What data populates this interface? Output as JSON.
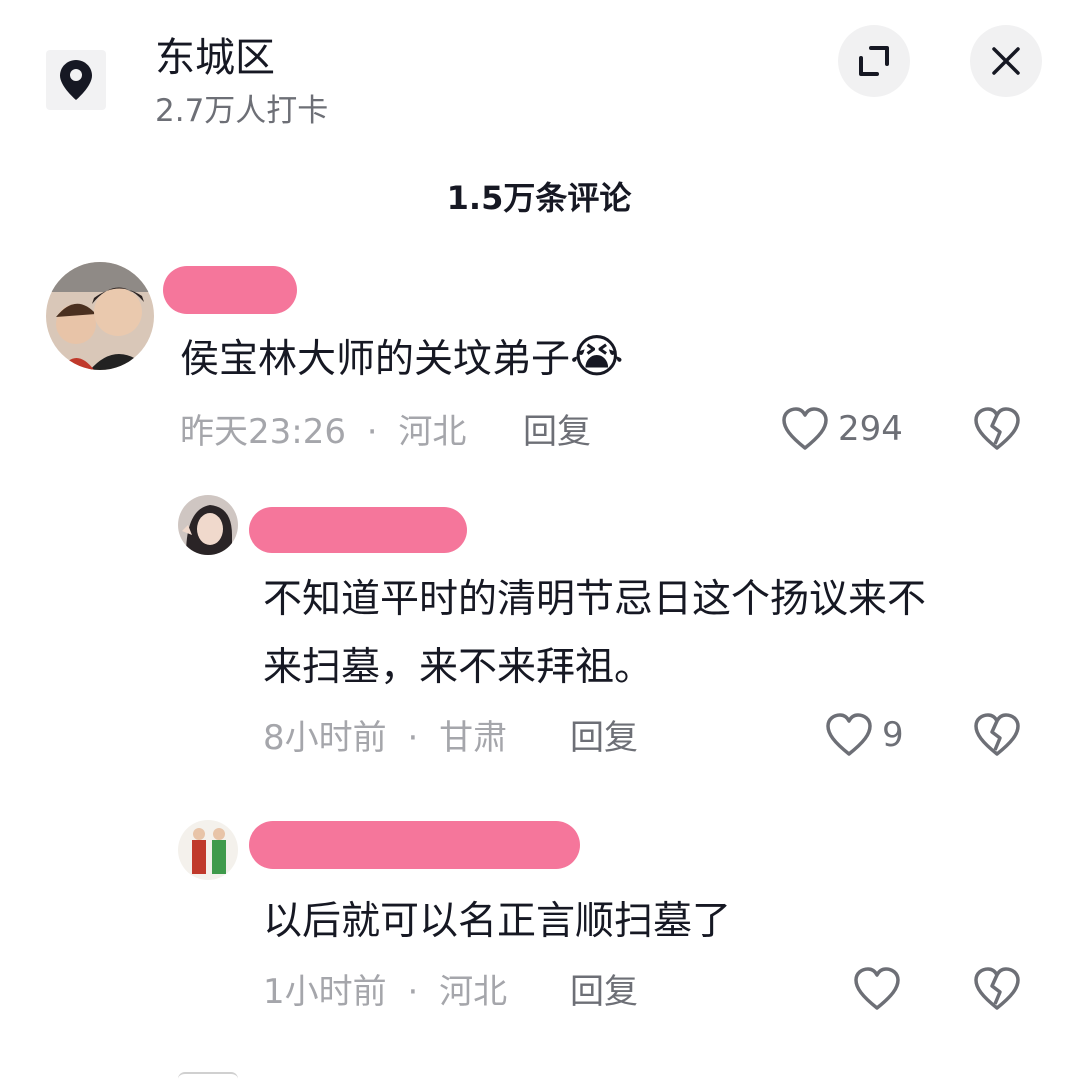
{
  "header": {
    "location_name": "东城区",
    "checkin_text": "2.7万人打卡",
    "location_icon": "location-pin-icon",
    "expand_icon": "expand-icon",
    "close_icon": "close-icon"
  },
  "comments_header": {
    "count_text": "1.5万条评论"
  },
  "comments": [
    {
      "text": "侯宝林大师的关坟弟子",
      "emoji": "😭",
      "time": "昨天23:26",
      "region": "河北",
      "reply_label": "回复",
      "likes": "294"
    },
    {
      "text_line1": "不知道平时的清明节忌日这个扬议来不",
      "text_line2": "来扫墓，来不来拜祖。",
      "time": "8小时前",
      "region": "甘肃",
      "reply_label": "回复",
      "likes": "9"
    },
    {
      "text": "以后就可以名正言顺扫墓了",
      "time": "1小时前",
      "region": "河北",
      "reply_label": "回复",
      "likes": ""
    }
  ],
  "colors": {
    "name_redaction": "#f5769b",
    "meta_gray": "#a5a6ab",
    "text_dark": "#161823"
  }
}
